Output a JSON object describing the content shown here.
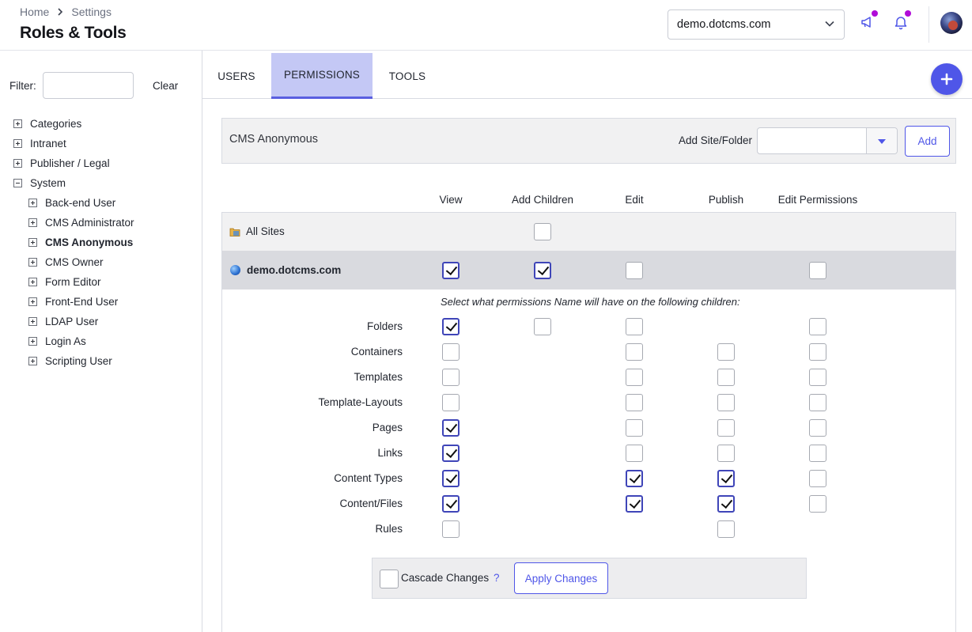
{
  "header": {
    "breadcrumb": [
      "Home",
      "Settings"
    ],
    "title": "Roles & Tools",
    "site_selector": "demo.dotcms.com"
  },
  "sidebar": {
    "filter_label": "Filter:",
    "filter_value": "",
    "clear_label": "Clear",
    "tree": [
      {
        "label": "Categories",
        "level": 0,
        "expanded": false
      },
      {
        "label": "Intranet",
        "level": 0,
        "expanded": false
      },
      {
        "label": "Publisher / Legal",
        "level": 0,
        "expanded": false
      },
      {
        "label": "System",
        "level": 0,
        "expanded": true
      },
      {
        "label": "Back-end User",
        "level": 1,
        "expanded": false
      },
      {
        "label": "CMS Administrator",
        "level": 1,
        "expanded": false
      },
      {
        "label": "CMS Anonymous",
        "level": 1,
        "expanded": false,
        "selected": true
      },
      {
        "label": "CMS Owner",
        "level": 1,
        "expanded": false
      },
      {
        "label": "Form Editor",
        "level": 1,
        "expanded": false
      },
      {
        "label": "Front-End User",
        "level": 1,
        "expanded": false
      },
      {
        "label": "LDAP User",
        "level": 1,
        "expanded": false
      },
      {
        "label": "Login As",
        "level": 1,
        "expanded": false
      },
      {
        "label": "Scripting User",
        "level": 1,
        "expanded": false
      }
    ]
  },
  "tabs": [
    {
      "label": "USERS",
      "active": false
    },
    {
      "label": "PERMISSIONS",
      "active": true
    },
    {
      "label": "TOOLS",
      "active": false
    }
  ],
  "role_bar": {
    "role_name": "CMS Anonymous",
    "add_site_label": "Add Site/Folder",
    "add_site_value": "",
    "add_button": "Add"
  },
  "permissions": {
    "columns": [
      "View",
      "Add Children",
      "Edit",
      "Publish",
      "Edit Permissions"
    ],
    "all_sites": {
      "label": "All Sites",
      "values": [
        null,
        false,
        null,
        null,
        null
      ]
    },
    "site": {
      "label": "demo.dotcms.com",
      "values": [
        true,
        true,
        false,
        null,
        false
      ]
    },
    "children_hint": "Select what permissions Name will have on the following children:",
    "children": [
      {
        "label": "Folders",
        "values": [
          true,
          false,
          false,
          null,
          false
        ]
      },
      {
        "label": "Containers",
        "values": [
          false,
          null,
          false,
          false,
          false
        ]
      },
      {
        "label": "Templates",
        "values": [
          false,
          null,
          false,
          false,
          false
        ]
      },
      {
        "label": "Template-Layouts",
        "values": [
          false,
          null,
          false,
          false,
          false
        ]
      },
      {
        "label": "Pages",
        "values": [
          true,
          null,
          false,
          false,
          false
        ]
      },
      {
        "label": "Links",
        "values": [
          true,
          null,
          false,
          false,
          false
        ]
      },
      {
        "label": "Content Types",
        "values": [
          true,
          null,
          true,
          true,
          false
        ]
      },
      {
        "label": "Content/Files",
        "values": [
          true,
          null,
          true,
          true,
          false
        ]
      },
      {
        "label": "Rules",
        "values": [
          false,
          null,
          null,
          false,
          null
        ]
      }
    ]
  },
  "actions": {
    "cascade_label": "Cascade Changes",
    "cascade_checked": false,
    "help": "?",
    "apply_button": "Apply Changes"
  },
  "colors": {
    "accent": "#4f56e8",
    "active_tab_bg": "#c4c8f5",
    "notification_dot": "#b00cd8"
  },
  "icons": [
    "chevron-right-icon",
    "chevron-down-icon",
    "megaphone-icon",
    "bell-icon",
    "plus-icon",
    "folder-icon",
    "globe-icon"
  ]
}
